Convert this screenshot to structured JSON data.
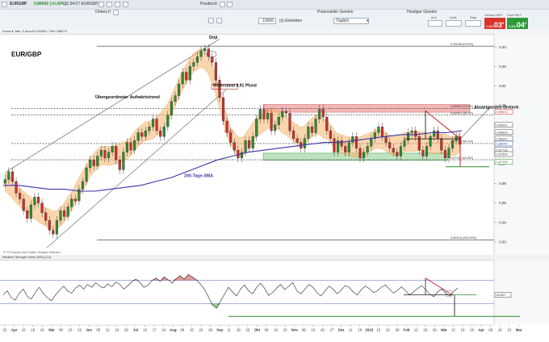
{
  "toolbar": {
    "symbol": "EURGBP",
    "price_change": "0,88042 (+0,43%)",
    "time_symbol": "11:04:07  EURGBP (-)",
    "orders_label": "Orders",
    "orders_value": "0",
    "position_label": "Position",
    "position_value": "0",
    "units_value": "10000",
    "units_label": "(x) Einheiten",
    "potential_label": "Potenzieller Gewinn",
    "timeframe": "Täglich",
    "today_label": "Heutiger Gewinn",
    "bid_label": "Verkauf MKT",
    "ask_label": "Kauf MKT",
    "bid_big": "03",
    "bid_prefix": "0,880",
    "bid_sup": "9",
    "ask_big": "04",
    "ask_prefix": "0,880",
    "ask_sup": "6",
    "col_anz": "Anz",
    "col_limit": "Limit",
    "col_stop": "Stop"
  },
  "panel_main_info": "Kurse ▾   Jahr: 0,4hoch 0,89250 / Tief 0,86073",
  "panel_rsi_info": "Relative Strength Index (RSI) (14)",
  "watermark": "© IT-Finance.com  Daten Jüngste Histroire",
  "colors": {
    "sma_line": "#3a35a8",
    "bollinger_band": "#f6b56e",
    "bull_candle": "#2f8a2f",
    "bear_candle": "#c83030",
    "resistance_zone": "#f4b6b6",
    "support_zone": "#bfe3c0",
    "rsi_line": "#222222",
    "rsi_green": "#57a85a",
    "rsi_red": "#c84646",
    "fib_lines": "#333333"
  },
  "chart_data": [
    {
      "type": "candlestick",
      "title": "EUR/GBP",
      "x_ticks": [
        "22",
        "Apr",
        "10",
        "18",
        "24",
        "Mai",
        "08",
        "15",
        "22",
        "Jun",
        "05",
        "12",
        "19",
        "26",
        "Jul",
        "10",
        "17",
        "24",
        "Aug",
        "08",
        "15",
        "22",
        "28",
        "Sep",
        "11",
        "18",
        "25",
        "Okt",
        "09",
        "16",
        "23",
        "Nov",
        "06",
        "13",
        "20",
        "27",
        "Dez",
        "11",
        "18",
        "2018",
        "15",
        "22",
        "29",
        "Feb",
        "12",
        "19",
        "26",
        "Mär",
        "12",
        "19",
        "26",
        "Apr",
        "09",
        "16",
        "23",
        "Mai"
      ],
      "y_ticks": [
        "0,93",
        "0,92",
        "0,91",
        "0,90",
        "0,89",
        "0,88",
        "0,87",
        "0,86",
        "0,85",
        "0,84",
        "0,83"
      ],
      "ylim": [
        0.825,
        0.935
      ],
      "y_axis_value_labels": [
        "0,89672",
        "0,89001",
        "0,88629",
        "0,88300",
        "0,88042",
        "0,87716",
        "0,87504",
        "0,87106"
      ],
      "fib_levels": [
        {
          "label": "0,93038 (0,00%)",
          "value": 0.93038
        },
        {
          "label": "0,89850 (23,6%)",
          "value": 0.8985
        },
        {
          "label": "0,89500 (38,2%)",
          "value": 0.895
        },
        {
          "label": "0,88045 (50,0%)",
          "value": 0.88045
        },
        {
          "label": "0,87210 (61,8%)",
          "value": 0.8721
        },
        {
          "label": "0,83104 (100,00%)",
          "value": 0.83104
        }
      ],
      "annotations": [
        "Doji",
        "Widerstand 0,91 Pfund",
        "Übergeordneter Aufwärtstrend",
        "Absteigendes Dreieck",
        "Kettn...",
        "200-Tage-SMA"
      ],
      "close": [
        0.862,
        0.866,
        0.861,
        0.855,
        0.852,
        0.846,
        0.842,
        0.849,
        0.853,
        0.85,
        0.845,
        0.841,
        0.836,
        0.834,
        0.841,
        0.846,
        0.843,
        0.848,
        0.852,
        0.851,
        0.857,
        0.861,
        0.868,
        0.872,
        0.869,
        0.874,
        0.877,
        0.873,
        0.876,
        0.879,
        0.872,
        0.867,
        0.876,
        0.881,
        0.877,
        0.882,
        0.886,
        0.884,
        0.887,
        0.889,
        0.893,
        0.887,
        0.884,
        0.889,
        0.895,
        0.902,
        0.905,
        0.911,
        0.917,
        0.913,
        0.92,
        0.922,
        0.925,
        0.928,
        0.929,
        0.925,
        0.922,
        0.913,
        0.904,
        0.892,
        0.886,
        0.881,
        0.877,
        0.873,
        0.876,
        0.882,
        0.878,
        0.884,
        0.893,
        0.898,
        0.893,
        0.896,
        0.887,
        0.89,
        0.894,
        0.897,
        0.896,
        0.887,
        0.883,
        0.881,
        0.878,
        0.883,
        0.889,
        0.886,
        0.893,
        0.898,
        0.894,
        0.887,
        0.883,
        0.876,
        0.882,
        0.879,
        0.876,
        0.881,
        0.884,
        0.878,
        0.873,
        0.876,
        0.879,
        0.883,
        0.886,
        0.889,
        0.884,
        0.881,
        0.878,
        0.876,
        0.874,
        0.879,
        0.882,
        0.886,
        0.887,
        0.884,
        0.877,
        0.874,
        0.879,
        0.884,
        0.887,
        0.883,
        0.877,
        0.873,
        0.878,
        0.882,
        0.884,
        0.88
      ],
      "sma200": [
        0.859,
        0.859,
        0.858,
        0.857,
        0.857,
        0.856,
        0.856,
        0.857,
        0.858,
        0.859,
        0.861,
        0.863,
        0.866,
        0.869,
        0.872,
        0.874,
        0.876,
        0.877,
        0.878,
        0.879,
        0.88,
        0.881,
        0.881,
        0.882,
        0.883,
        0.884,
        0.885,
        0.885,
        0.886,
        0.886,
        0.887
      ],
      "resistance_zone": [
        0.8965,
        0.9005
      ],
      "support_zone": [
        0.8718,
        0.8755
      ]
    },
    {
      "type": "line",
      "title": "Relative Strength Index (RSI) (14)",
      "y_ticks": [
        "43,607"
      ],
      "ylim": [
        0,
        100
      ],
      "rsi_levels": [
        70,
        30
      ],
      "values": [
        45,
        52,
        40,
        36,
        48,
        55,
        42,
        38,
        50,
        58,
        47,
        40,
        35,
        45,
        53,
        60,
        52,
        48,
        57,
        62,
        55,
        63,
        58,
        66,
        60,
        57,
        64,
        59,
        67,
        63,
        55,
        61,
        68,
        72,
        66,
        58,
        62,
        70,
        74,
        68,
        76,
        71,
        65,
        73,
        78,
        72,
        80,
        76,
        71,
        64,
        55,
        42,
        28,
        22,
        34,
        46,
        58,
        50,
        43,
        55,
        62,
        52,
        47,
        58,
        65,
        56,
        44,
        49,
        57,
        63,
        54,
        60,
        66,
        52,
        47,
        55,
        63,
        58,
        49,
        43,
        52,
        60,
        55,
        47,
        53,
        61,
        58,
        50,
        45,
        54,
        60,
        56,
        49,
        52,
        58,
        62,
        55,
        48,
        53,
        59,
        52,
        45,
        50,
        56,
        61,
        54,
        47,
        42,
        50,
        55,
        48,
        43,
        51,
        57
      ]
    }
  ]
}
